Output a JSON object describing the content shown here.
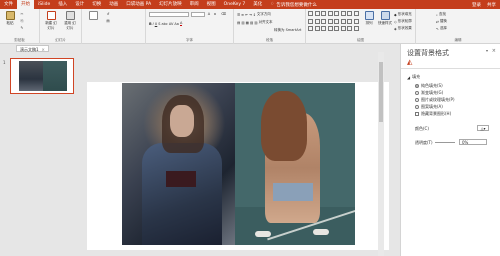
{
  "tabs": [
    "文件",
    "开始",
    "iSlide",
    "插入",
    "设计",
    "切换",
    "动画",
    "口袋动画 PA",
    "幻灯片放映",
    "审阅",
    "视图",
    "OneKey 7",
    "美化"
  ],
  "search_placeholder": "告诉我您想要做什么",
  "account": [
    "登录",
    "共享"
  ],
  "ribbon": {
    "groups": [
      "剪贴板",
      "幻灯片",
      "字体",
      "段落",
      "绘图",
      "编辑"
    ],
    "paste": "粘贴",
    "new_slide": "新建\n幻灯片",
    "reuse": "重用\n幻灯片",
    "font_name": "",
    "font_size": "",
    "arrange": "排列",
    "quick_styles": "快速样式",
    "shape_fill": "形状填充",
    "shape_outline": "形状轮廓",
    "shape_effect": "形状效果",
    "find": "查找",
    "replace": "替换",
    "select": "选择",
    "text_direction": "文字方向",
    "align_text": "对齐文本",
    "smartart": "转换为 SmartArt"
  },
  "doc": {
    "tab_label": "演示文稿1",
    "close": "×"
  },
  "thumb": {
    "number": "1"
  },
  "pane": {
    "title": "设置背景格式",
    "close": "×",
    "down": "▾",
    "section": "填充",
    "options": [
      "纯色填充(S)",
      "渐变填充(G)",
      "图片或纹理填充(P)",
      "图案填充(A)",
      "隐藏背景图形(H)"
    ],
    "color_label": "颜色(C)",
    "color_btn": "▾",
    "transparency_label": "透明度(T)",
    "transparency_value": "0%"
  },
  "colors": {
    "accent": "#c43e1c"
  }
}
